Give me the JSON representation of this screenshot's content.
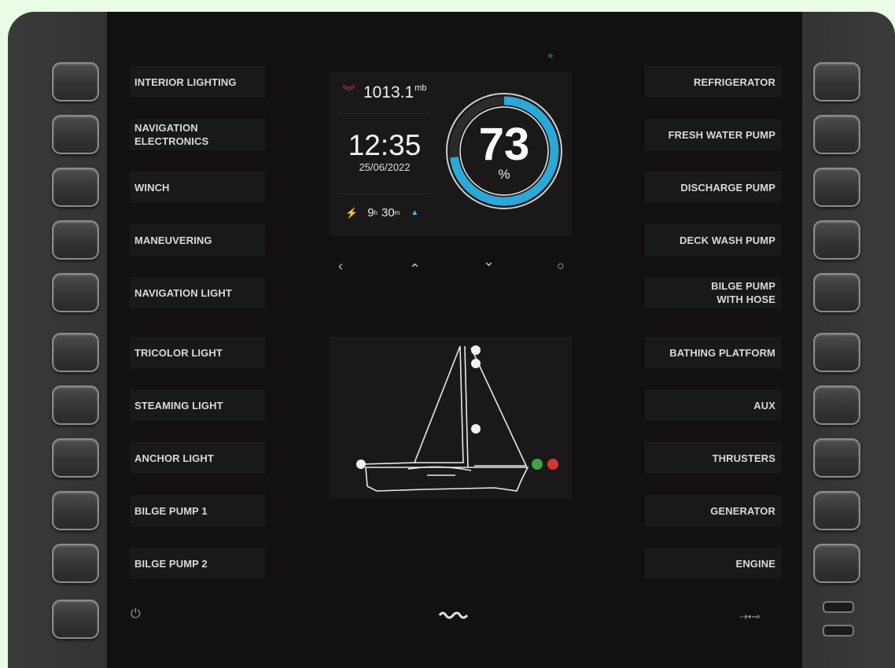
{
  "left_labels": [
    "INTERIOR LIGHTING",
    "NAVIGATION\nELECTRONICS",
    "WINCH",
    "MANEUVERING",
    "NAVIGATION LIGHT",
    "TRICOLOR LIGHT",
    "STEAMING LIGHT",
    "ANCHOR LIGHT",
    "BILGE PUMP 1",
    "BILGE PUMP 2"
  ],
  "right_labels": [
    "REFRIGERATOR",
    "FRESH WATER PUMP",
    "DISCHARGE PUMP",
    "DECK WASH PUMP",
    "BILGE PUMP\nWITH HOSE",
    "BATHING PLATFORM",
    "AUX",
    "THRUSTERS",
    "GENERATOR",
    "ENGINE"
  ],
  "dashboard": {
    "pressure_value": "1013.1",
    "pressure_unit": "mb",
    "pressure_trend_icon": "double-chevron-down-icon",
    "time": "12:35",
    "date": "25/06/2022",
    "remaining_hours": "9",
    "remaining_hours_unit": "h",
    "remaining_minutes": "30",
    "remaining_minutes_unit": "m",
    "battery_percent": 73,
    "battery_percent_text": "73",
    "battery_unit": "%",
    "gauge_color": "#2aa8d8",
    "trend_down_color": "#d9342b",
    "trend_up_color": "#3ec3e3"
  },
  "nav": {
    "prev_icon": "chevron-left-icon",
    "up_icon": "chevron-up-icon",
    "down_icon": "chevron-down-icon",
    "refresh_icon": "refresh-icon",
    "prev": "‹",
    "up": "⌃",
    "down": "⌄",
    "refresh": "○"
  },
  "boat": {
    "lights_on": [
      "mast-top",
      "mast-second",
      "steaming",
      "stern"
    ],
    "starboard_color": "#3fa34d",
    "port_color": "#d9342b"
  },
  "footer": {
    "power_icon": "power-icon",
    "logo_icon": "waves-logo-icon",
    "usb_icon": "usb-icon",
    "power": "⏻",
    "usb": "⇢•⊸"
  }
}
